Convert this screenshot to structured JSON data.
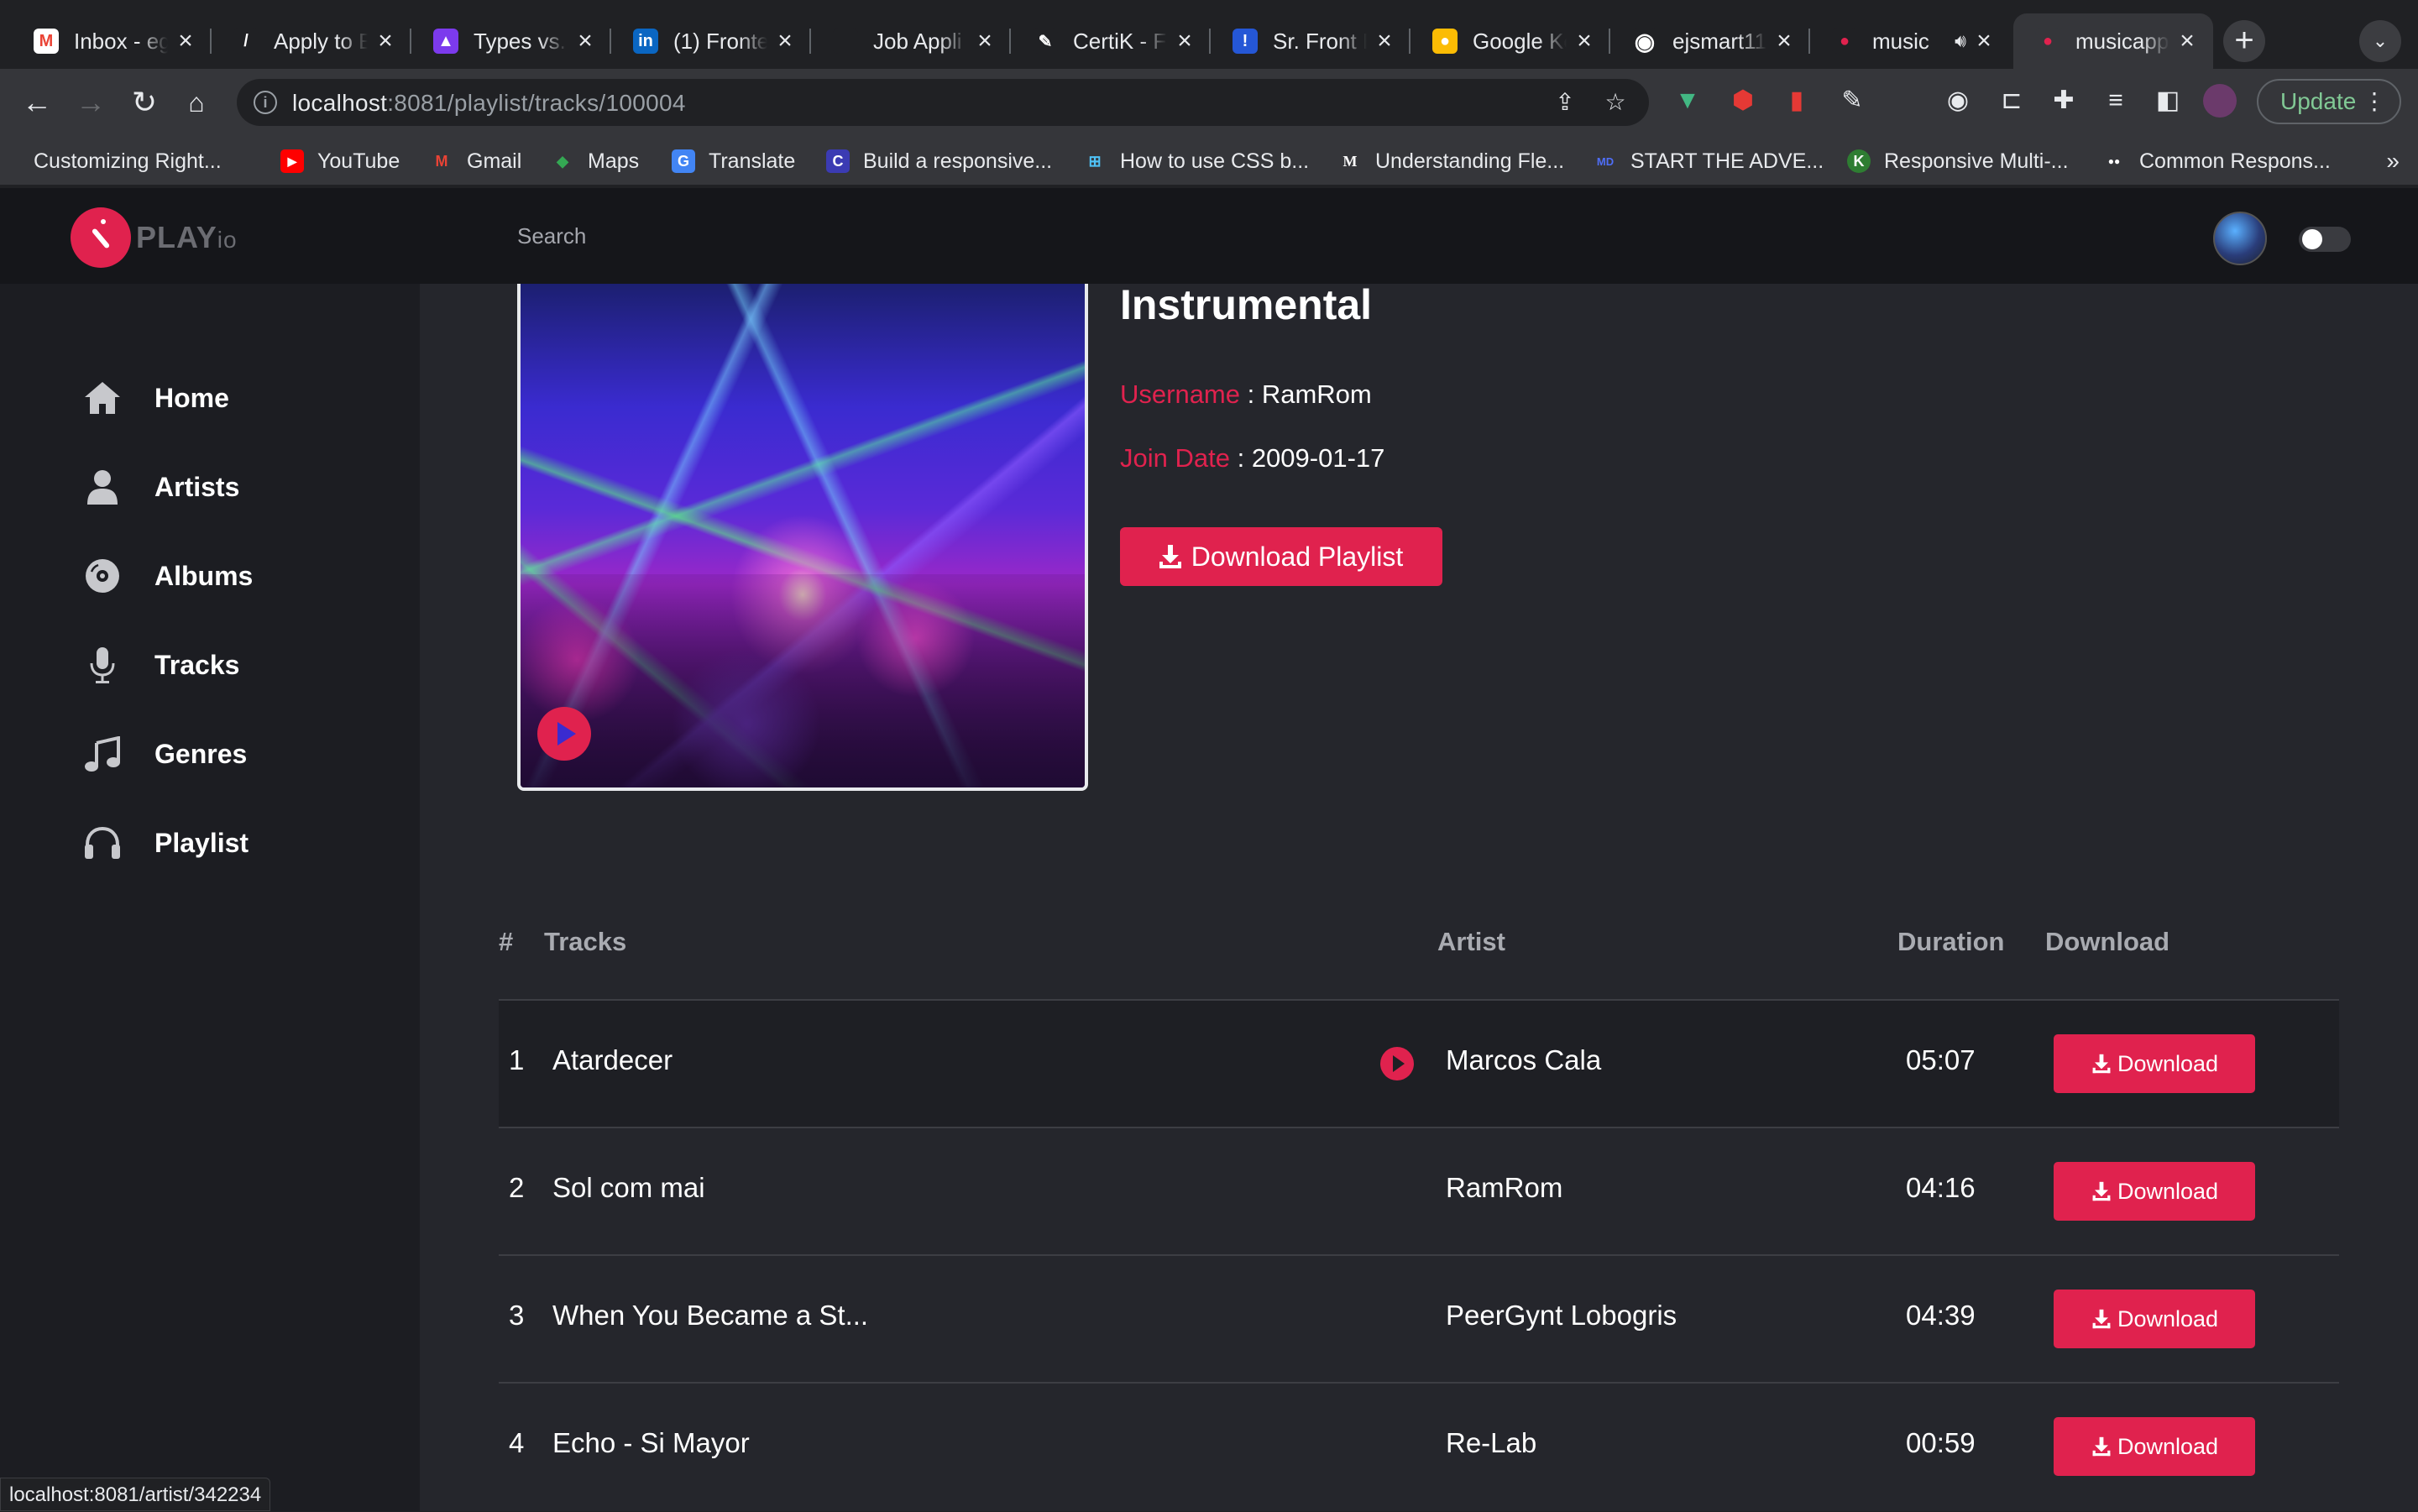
{
  "browser": {
    "tabs": [
      {
        "title": "Inbox - eg",
        "fav": "M",
        "color": "#ea4335"
      },
      {
        "title": "Apply to E",
        "fav": "/",
        "color": "#202124"
      },
      {
        "title": "Types vs.",
        "fav": "▲",
        "color": "#7c3aed"
      },
      {
        "title": "(1) Fronte",
        "fav": "in",
        "color": "#0a66c2"
      },
      {
        "title": "Job Appli",
        "fav": "",
        "color": "#202124"
      },
      {
        "title": "CertiK - F",
        "fav": "✎",
        "color": "#202124"
      },
      {
        "title": "Sr. Front E",
        "fav": "!",
        "color": "#2557d6"
      },
      {
        "title": "Google Ke",
        "fav": "●",
        "color": "#fbbc04"
      },
      {
        "title": "ejsmart11",
        "fav": "◉",
        "color": "#202124"
      },
      {
        "title": "music",
        "fav": "●",
        "color": "#e0224e"
      },
      {
        "title": "musicapp",
        "fav": "●",
        "color": "#e0224e"
      }
    ],
    "url_host": "localhost",
    "url_path": ":8081/playlist/tracks/100004",
    "update_label": "Update",
    "bookmarks": [
      {
        "label": "Customizing Right...",
        "icon": "",
        "color": "#35363a"
      },
      {
        "label": "YouTube",
        "icon": "▶",
        "color": "#ff0000"
      },
      {
        "label": "Gmail",
        "icon": "M",
        "color": "#ea4335"
      },
      {
        "label": "Maps",
        "icon": "◆",
        "color": "#34a853"
      },
      {
        "label": "Translate",
        "icon": "G",
        "color": "#4285f4"
      },
      {
        "label": "Build a responsive...",
        "icon": "C",
        "color": "#3b3bb3"
      },
      {
        "label": "How to use CSS b...",
        "icon": "⊞",
        "color": "#35363a"
      },
      {
        "label": "Understanding Fle...",
        "icon": "M",
        "color": "#35363a"
      },
      {
        "label": "START THE ADVE...",
        "icon": "MD",
        "color": "#35363a"
      },
      {
        "label": "Responsive Multi-...",
        "icon": "K",
        "color": "#2e7d32"
      },
      {
        "label": "Common Respons...",
        "icon": "●●",
        "color": "#35363a"
      }
    ],
    "status_url": "localhost:8081/artist/342234"
  },
  "app": {
    "brand": "PLAY",
    "brand_suffix": "io",
    "search_placeholder": "Search",
    "nav": [
      {
        "label": "Home",
        "icon": "home-icon"
      },
      {
        "label": "Artists",
        "icon": "user-icon"
      },
      {
        "label": "Albums",
        "icon": "disc-icon"
      },
      {
        "label": "Tracks",
        "icon": "microphone-icon"
      },
      {
        "label": "Genres",
        "icon": "music-note-icon"
      },
      {
        "label": "Playlist",
        "icon": "headphones-icon"
      }
    ]
  },
  "playlist": {
    "title": "Instrumental",
    "username_label": "Username",
    "username": "RamRom",
    "join_label": "Join Date",
    "join_date": "2009-01-17",
    "download_label": "Download Playlist"
  },
  "table": {
    "headers": {
      "num": "#",
      "tracks": "Tracks",
      "artist": "Artist",
      "duration": "Duration",
      "download": "Download"
    },
    "rows": [
      {
        "num": "1",
        "name": "Atardecer",
        "artist": "Marcos Cala",
        "duration": "05:07",
        "download": "Download"
      },
      {
        "num": "2",
        "name": "Sol com mai",
        "artist": "RamRom",
        "duration": "04:16",
        "download": "Download"
      },
      {
        "num": "3",
        "name": "When You Became a St...",
        "artist": "PeerGynt Lobogris",
        "duration": "04:39",
        "download": "Download"
      },
      {
        "num": "4",
        "name": "Echo - Si Mayor",
        "artist": "Re-Lab",
        "duration": "00:59",
        "download": "Download"
      }
    ]
  },
  "colors": {
    "accent": "#e0224e",
    "background": "#25262c",
    "sidebar": "#1c1d22"
  }
}
